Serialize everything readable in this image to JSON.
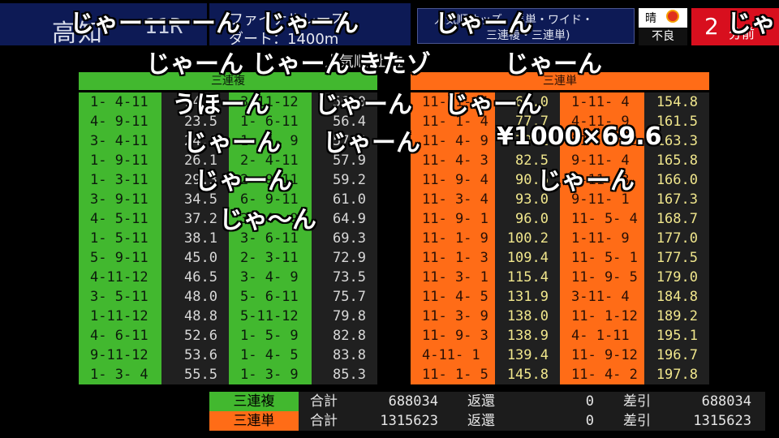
{
  "header": {
    "venue": "高知",
    "race_no": "11R",
    "race_name": "ファイナルレース",
    "distance": "ダート：1400m",
    "odds_line1": "人気順オッズ　馬単・ワイド・",
    "odds_line2": "三連複・三連単)",
    "weather": "晴",
    "condition": "不良",
    "minutes": "2",
    "minutes_unit": "分前",
    "subtitle": "人気順(上位"
  },
  "trio": {
    "title": "三連複",
    "color": "#42b82f",
    "left": [
      {
        "combo": "1- 4-11",
        "odds": "14.0"
      },
      {
        "combo": "4- 9-11",
        "odds": "23.5"
      },
      {
        "combo": "3- 4-11",
        "odds": "24.1"
      },
      {
        "combo": "1- 9-11",
        "odds": "26.1"
      },
      {
        "combo": "1- 3-11",
        "odds": "29.3"
      },
      {
        "combo": "3- 9-11",
        "odds": "34.5"
      },
      {
        "combo": "4- 5-11",
        "odds": "37.2"
      },
      {
        "combo": "1- 5-11",
        "odds": "38.1"
      },
      {
        "combo": "5- 9-11",
        "odds": "45.0"
      },
      {
        "combo": "4-11-12",
        "odds": "46.5"
      },
      {
        "combo": "3- 5-11",
        "odds": "48.0"
      },
      {
        "combo": "1-11-12",
        "odds": "48.8"
      },
      {
        "combo": "4- 6-11",
        "odds": "52.6"
      },
      {
        "combo": "9-11-12",
        "odds": "53.6"
      },
      {
        "combo": "1- 3- 4",
        "odds": "55.5"
      }
    ],
    "right": [
      {
        "combo": "3-11-12",
        "odds": "56.0"
      },
      {
        "combo": "1- 6-11",
        "odds": "56.4"
      },
      {
        "combo": "1- 4- 9",
        "odds": "57.0"
      },
      {
        "combo": "2- 4-11",
        "odds": "57.9"
      },
      {
        "combo": "2- 9-11",
        "odds": "59.2"
      },
      {
        "combo": "6- 9-11",
        "odds": "61.0"
      },
      {
        "combo": "3- 4- 9",
        "odds": "64.9"
      },
      {
        "combo": "3- 6-11",
        "odds": "69.3"
      },
      {
        "combo": "2- 3-11",
        "odds": "72.9"
      },
      {
        "combo": "3- 4- 9",
        "odds": "73.5"
      },
      {
        "combo": "5- 6-11",
        "odds": "75.7"
      },
      {
        "combo": "5-11-12",
        "odds": "79.8"
      },
      {
        "combo": "1- 5- 9",
        "odds": "82.8"
      },
      {
        "combo": "1- 4- 5",
        "odds": "83.8"
      },
      {
        "combo": "1- 3- 9",
        "odds": "85.3"
      }
    ]
  },
  "trifecta": {
    "title": "三連単",
    "color": "#ff6c17",
    "left": [
      {
        "combo": "11- 1- 4",
        "odds": "68.0"
      },
      {
        "combo": "11- 1- 4",
        "odds": "77.7"
      },
      {
        "combo": "11- 4- 9",
        "odds": "79.1"
      },
      {
        "combo": "11- 4- 3",
        "odds": "82.5"
      },
      {
        "combo": "11- 9- 4",
        "odds": "90.6"
      },
      {
        "combo": "11- 3- 4",
        "odds": "93.0"
      },
      {
        "combo": "11- 9- 1",
        "odds": "96.0"
      },
      {
        "combo": "11- 1- 9",
        "odds": "100.2"
      },
      {
        "combo": "11- 1- 3",
        "odds": "109.4"
      },
      {
        "combo": "11- 3- 1",
        "odds": "115.4"
      },
      {
        "combo": "11- 4- 5",
        "odds": "131.9"
      },
      {
        "combo": "11- 3- 9",
        "odds": "138.0"
      },
      {
        "combo": "11- 9- 3",
        "odds": "138.9"
      },
      {
        "combo": "4-11- 1",
        "odds": "139.4"
      },
      {
        "combo": "11- 1- 5",
        "odds": "145.8"
      }
    ],
    "right": [
      {
        "combo": "1-11- 4",
        "odds": "154.8"
      },
      {
        "combo": "4-11- 9",
        "odds": "161.5"
      },
      {
        "combo": "11- 4-12",
        "odds": "163.3"
      },
      {
        "combo": "9-11- 4",
        "odds": "165.8"
      },
      {
        "combo": "4-11- 3",
        "odds": "166.0"
      },
      {
        "combo": "9-11- 1",
        "odds": "167.3"
      },
      {
        "combo": "11- 5- 4",
        "odds": "168.7"
      },
      {
        "combo": "1-11- 9",
        "odds": "177.0"
      },
      {
        "combo": "11- 5- 1",
        "odds": "177.5"
      },
      {
        "combo": "11- 9- 5",
        "odds": "179.0"
      },
      {
        "combo": "3-11- 4",
        "odds": "184.8"
      },
      {
        "combo": "11- 1-12",
        "odds": "189.2"
      },
      {
        "combo": "4- 1-11",
        "odds": "195.1"
      },
      {
        "combo": "11- 9-12",
        "odds": "196.7"
      },
      {
        "combo": "11- 4- 2",
        "odds": "197.8"
      }
    ]
  },
  "footer": [
    {
      "label": "三連複",
      "color": "#42b82f",
      "total_label": "合計",
      "total": "688034",
      "refund_label": "返還",
      "refund": "0",
      "diff_label": "差引",
      "diff": "688034"
    },
    {
      "label": "三連単",
      "color": "#ff6c17",
      "total_label": "合計",
      "total": "1315623",
      "refund_label": "返還",
      "refund": "0",
      "diff_label": "差引",
      "diff": "1315623"
    }
  ],
  "comments": [
    "じゃーーーーん",
    "じゃーん",
    "じゃーん",
    "じゃ",
    "じゃーん じゃーん きたゾ",
    "じゃーん",
    "うほーん",
    "じゃーん",
    "じゃーん",
    "じゃーん",
    "じゃーん",
    "¥1000×69.6",
    "じゃーん",
    "じゃーん",
    "じゃ〜ん"
  ]
}
